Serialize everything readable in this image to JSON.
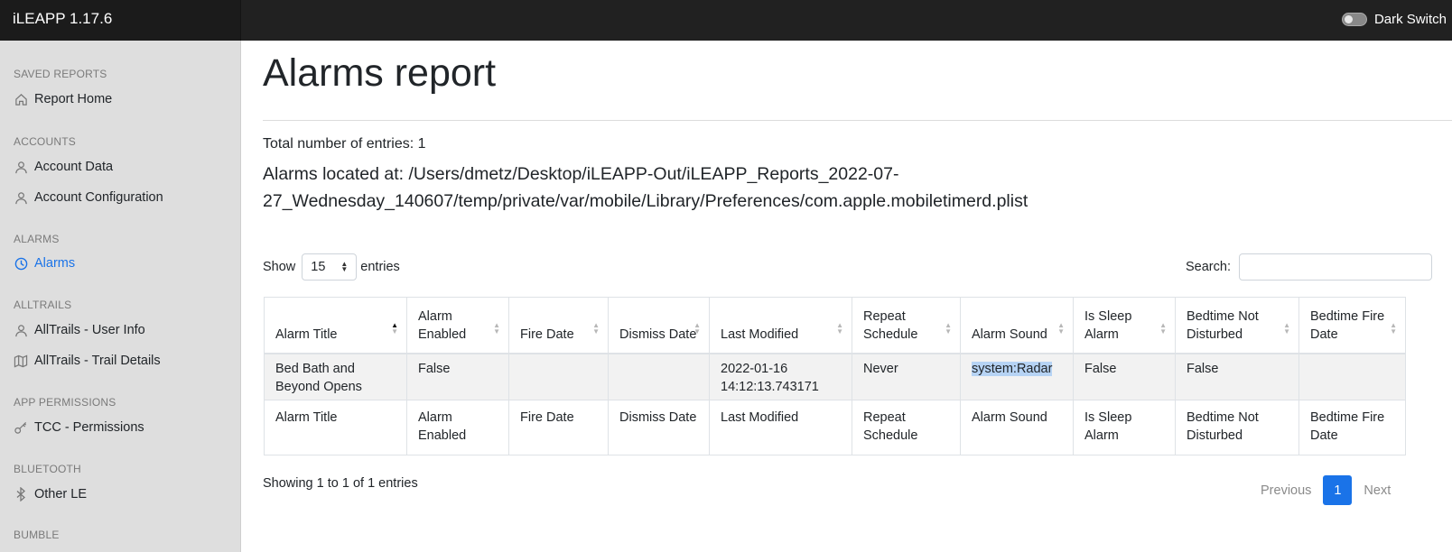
{
  "app": {
    "title": "iLEAPP 1.17.6",
    "dark_switch_label": "Dark Switch"
  },
  "sidebar": {
    "sections": [
      {
        "heading": "SAVED REPORTS",
        "items": [
          {
            "label": "Report Home",
            "icon": "home-icon"
          }
        ]
      },
      {
        "heading": "ACCOUNTS",
        "items": [
          {
            "label": "Account Data",
            "icon": "user-icon"
          },
          {
            "label": "Account Configuration",
            "icon": "user-icon"
          }
        ]
      },
      {
        "heading": "ALARMS",
        "items": [
          {
            "label": "Alarms",
            "icon": "clock-icon",
            "active": true
          }
        ]
      },
      {
        "heading": "ALLTRAILS",
        "items": [
          {
            "label": "AllTrails - User Info",
            "icon": "user-icon"
          },
          {
            "label": "AllTrails - Trail Details",
            "icon": "map-icon"
          }
        ]
      },
      {
        "heading": "APP PERMISSIONS",
        "items": [
          {
            "label": "TCC - Permissions",
            "icon": "key-icon"
          }
        ]
      },
      {
        "heading": "BLUETOOTH",
        "items": [
          {
            "label": "Other LE",
            "icon": "bluetooth-icon"
          }
        ]
      },
      {
        "heading": "BUMBLE",
        "items": []
      }
    ]
  },
  "main": {
    "title": "Alarms report",
    "total_entries": "Total number of entries: 1",
    "located_at": "Alarms located at: /Users/dmetz/Desktop/iLEAPP-Out/iLEAPP_Reports_2022-07-27_Wednesday_140607/temp/private/var/mobile/Library/Preferences/com.apple.mobiletimerd.plist",
    "show_label": "Show",
    "show_value": "15",
    "entries_label": "entries",
    "search_label": "Search:",
    "search_value": ""
  },
  "table": {
    "headers": [
      "Alarm Title",
      "Alarm Enabled",
      "Fire Date",
      "Dismiss Date",
      "Last Modified",
      "Repeat Schedule",
      "Alarm Sound",
      "Is Sleep Alarm",
      "Bedtime Not Disturbed",
      "Bedtime Fire Date"
    ],
    "rows": [
      [
        "Bed Bath and Beyond Opens",
        "False",
        "",
        "",
        "2022-01-16 14:12:13.743171",
        "Never",
        "system:Radar",
        "False",
        "False",
        ""
      ]
    ],
    "footer": [
      "Alarm Title",
      "Alarm Enabled",
      "Fire Date",
      "Dismiss Date",
      "Last Modified",
      "Repeat Schedule",
      "Alarm Sound",
      "Is Sleep Alarm",
      "Bedtime Not Disturbed",
      "Bedtime Fire Date"
    ]
  },
  "pagination": {
    "info": "Showing 1 to 1 of 1 entries",
    "previous": "Previous",
    "current": "1",
    "next": "Next"
  },
  "colors": {
    "topbar": "#212121",
    "sidebar": "#dedede",
    "accent": "#1a73e8"
  }
}
